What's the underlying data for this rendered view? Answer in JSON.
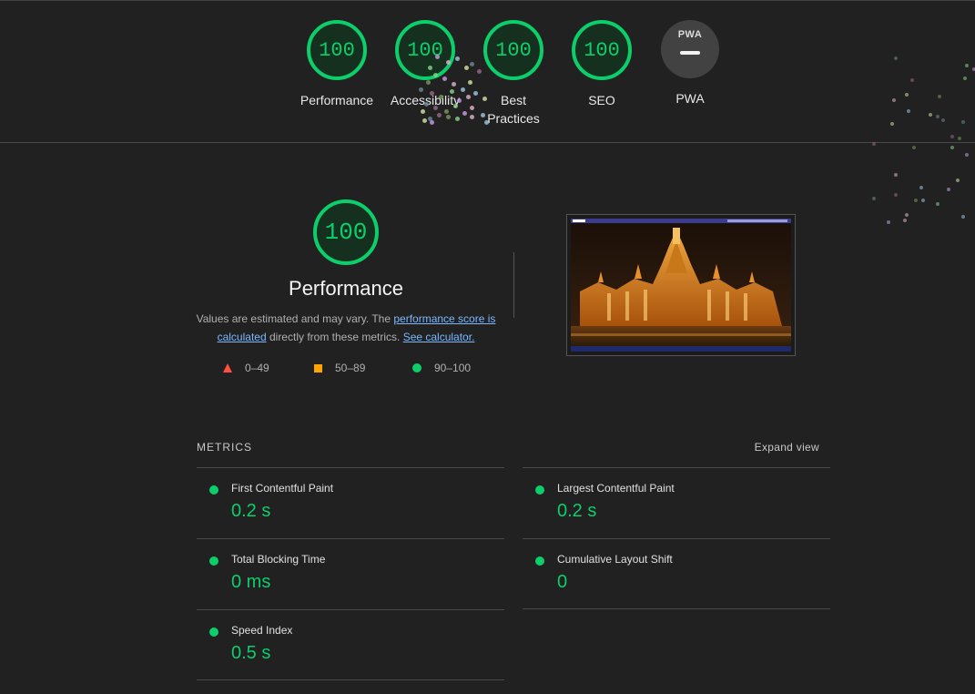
{
  "categories": [
    {
      "score": "100",
      "label": "Performance"
    },
    {
      "score": "100",
      "label": "Accessibility"
    },
    {
      "score": "100",
      "label": "Best Practices"
    },
    {
      "score": "100",
      "label": "SEO"
    }
  ],
  "pwa": {
    "badge": "PWA",
    "label": "PWA"
  },
  "performance": {
    "score": "100",
    "title": "Performance",
    "desc_prefix": "Values are estimated and may vary. The ",
    "desc_link": "performance score is calculated",
    "desc_middle": " directly from these metrics. ",
    "desc_calc_link": "See calculator.",
    "legend": {
      "fail": "0–49",
      "average": "50–89",
      "pass": "90–100"
    }
  },
  "metrics": {
    "title": "METRICS",
    "expand": "Expand view",
    "items": [
      {
        "label": "First Contentful Paint",
        "value": "0.2 s"
      },
      {
        "label": "Largest Contentful Paint",
        "value": "0.2 s"
      },
      {
        "label": "Total Blocking Time",
        "value": "0 ms"
      },
      {
        "label": "Cumulative Layout Shift",
        "value": "0"
      },
      {
        "label": "Speed Index",
        "value": "0.5 s"
      }
    ]
  },
  "colors": {
    "pass": "#0cce6b",
    "average": "#ffa400",
    "fail": "#ff4e42",
    "link": "#7cb8ff",
    "background": "#212121"
  }
}
